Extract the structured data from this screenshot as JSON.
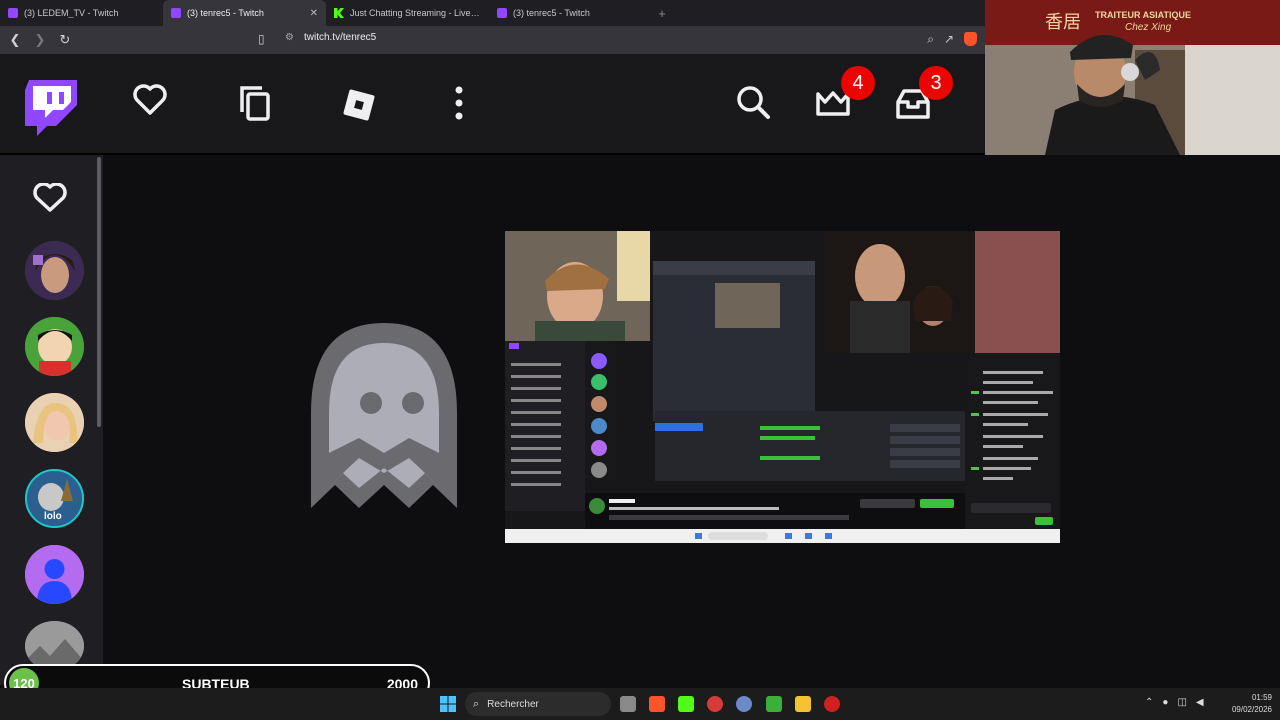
{
  "browser": {
    "tabs": [
      {
        "title": "(3) LEDEM_TV - Twitch",
        "icon": "twitch"
      },
      {
        "title": "(3) tenrec5 - Twitch",
        "icon": "twitch",
        "active": true
      },
      {
        "title": "Just Chatting Streaming - Live Stream",
        "icon": "kick"
      },
      {
        "title": "(3) tenrec5 - Twitch",
        "icon": "twitch"
      }
    ],
    "new_tab": "+",
    "url": "twitch.tv/tenrec5"
  },
  "topnav": {
    "notifications_count": "4",
    "inbox_count": "3"
  },
  "webcam": {
    "sign_text": "TRAITEUR ASIATIQUE",
    "sign_text_2": "Chez Xing",
    "sign_chinese": "香居"
  },
  "sidebar": {
    "avatars": [
      {
        "name": "channel-1",
        "color": "#6b4a8a"
      },
      {
        "name": "channel-2",
        "color": "#4aa23a"
      },
      {
        "name": "channel-3",
        "color": "#e3c59a"
      },
      {
        "name": "channel-4",
        "color": "#2a7f8f",
        "text": "lolo"
      },
      {
        "name": "channel-5",
        "color": "#b36cf0"
      },
      {
        "name": "channel-6",
        "color": "#8a8a8a"
      }
    ]
  },
  "subgoal": {
    "count": "120",
    "label": "SUBTEUB",
    "goal": "2000"
  },
  "taskbar": {
    "search_placeholder": "Rechercher",
    "time": "01:59",
    "date": "09/02/2026"
  },
  "colors": {
    "twitch_purple": "#9146ff",
    "badge_red": "#eb0400",
    "subgoal_green": "#6cc04a"
  }
}
